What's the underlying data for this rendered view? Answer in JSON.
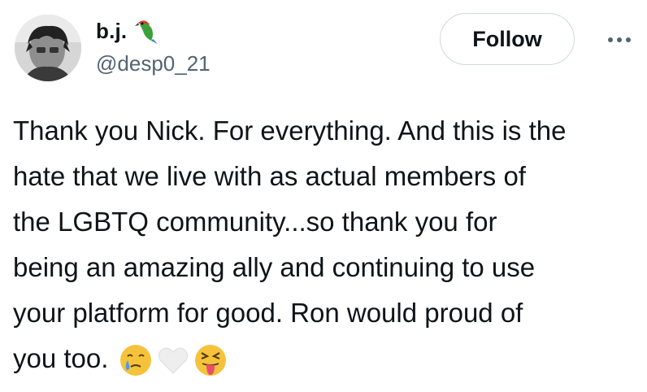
{
  "author": {
    "display_name": "b.j.",
    "name_emoji": "parrot-icon",
    "handle": "@desp0_21",
    "avatar": "avatar"
  },
  "actions": {
    "follow_label": "Follow",
    "more_icon": "more-horizontal-icon"
  },
  "tweet": {
    "lines": [
      "Thank you Nick. For everything. And this is the",
      "hate that we live with as actual members of",
      "the LGBTQ community...so thank you for",
      "being an amazing ally and continuing to use",
      "your platform for good. Ron would proud of",
      "you too."
    ],
    "trailing_emojis": [
      "crying-face-icon",
      "white-heart-icon",
      "squinting-tongue-face-icon"
    ]
  },
  "colors": {
    "text_primary": "#0f1419",
    "text_secondary": "#536471",
    "border": "#cfd9de",
    "background": "#ffffff"
  }
}
